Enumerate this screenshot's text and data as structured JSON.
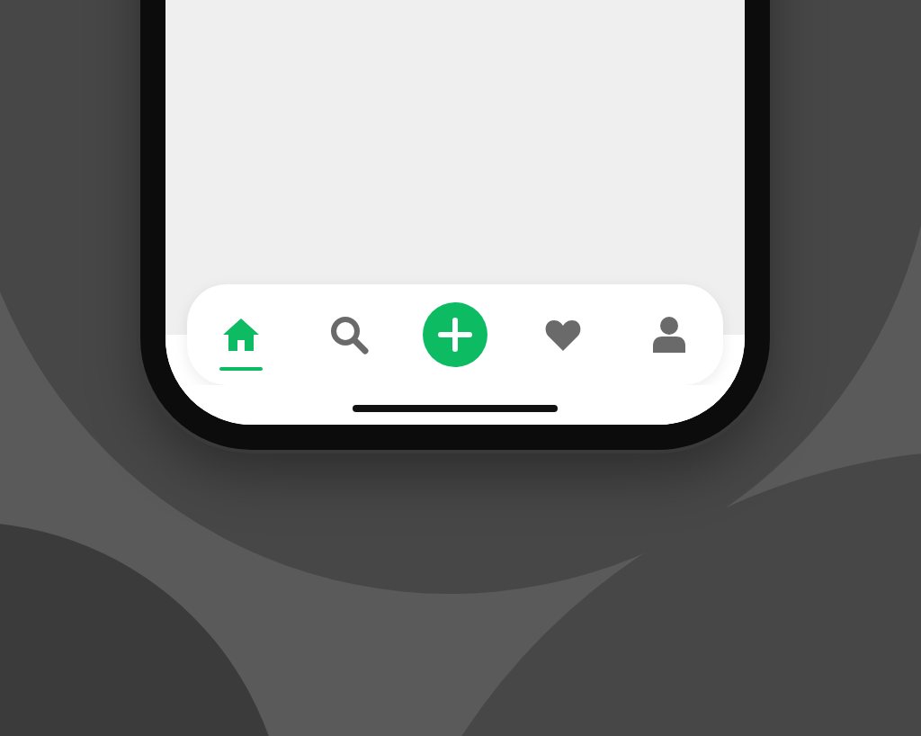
{
  "tab_bar": {
    "tabs": [
      {
        "kind": "home",
        "selected": true
      },
      {
        "kind": "search",
        "selected": false
      },
      {
        "kind": "add",
        "selected": false
      },
      {
        "kind": "heart",
        "selected": false
      },
      {
        "kind": "person",
        "selected": false
      }
    ]
  }
}
